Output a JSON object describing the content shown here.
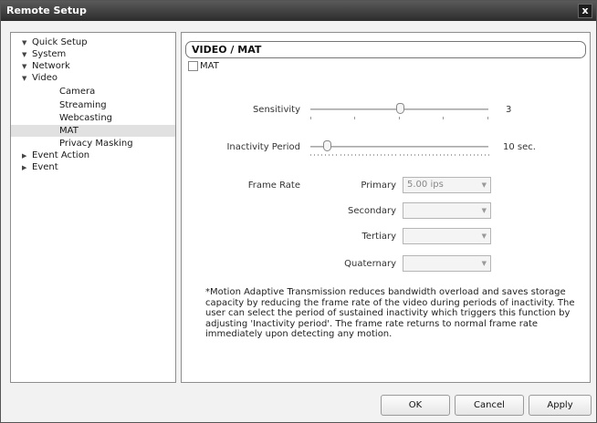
{
  "window": {
    "title": "Remote Setup",
    "close_label": "x"
  },
  "tree": {
    "items": [
      {
        "label": "Quick Setup",
        "arrow": "▼"
      },
      {
        "label": "System",
        "arrow": "▼"
      },
      {
        "label": "Network",
        "arrow": "▼"
      },
      {
        "label": "Video",
        "arrow": "▼"
      },
      {
        "label": "Camera"
      },
      {
        "label": "Streaming"
      },
      {
        "label": "Webcasting"
      },
      {
        "label": "MAT",
        "selected": true
      },
      {
        "label": "Privacy Masking"
      },
      {
        "label": "Event Action",
        "arrow": "▶"
      },
      {
        "label": "Event",
        "arrow": "▶"
      }
    ]
  },
  "panel": {
    "title": "VIDEO / MAT",
    "mat_checkbox": {
      "label": "MAT",
      "checked": false
    },
    "sensitivity": {
      "label": "Sensitivity",
      "value": "3",
      "value_numeric": 3,
      "min": 1,
      "max": 5
    },
    "inactivity": {
      "label": "Inactivity Period",
      "value": "10",
      "unit": "sec.",
      "value_numeric": 10,
      "min": 5,
      "max": 60
    },
    "frame_rate": {
      "label": "Frame Rate",
      "rows": [
        {
          "label": "Primary",
          "value": "5.00 ips"
        },
        {
          "label": "Secondary",
          "value": ""
        },
        {
          "label": "Tertiary",
          "value": ""
        },
        {
          "label": "Quaternary",
          "value": ""
        }
      ]
    },
    "note": "*Motion Adaptive Transmission reduces bandwidth overload and saves storage capacity by reducing the frame rate of the video during periods of inactivity. The user can select the period of sustained inactivity which triggers this function by adjusting 'Inactivity period'. The frame rate returns to normal frame rate immediately upon detecting any motion."
  },
  "buttons": {
    "ok": "OK",
    "cancel": "Cancel",
    "apply": "Apply"
  },
  "colors": {
    "titlebar": "#2c2c2c",
    "selected_row": "#e1e1e1",
    "border": "#8e8e8e"
  }
}
